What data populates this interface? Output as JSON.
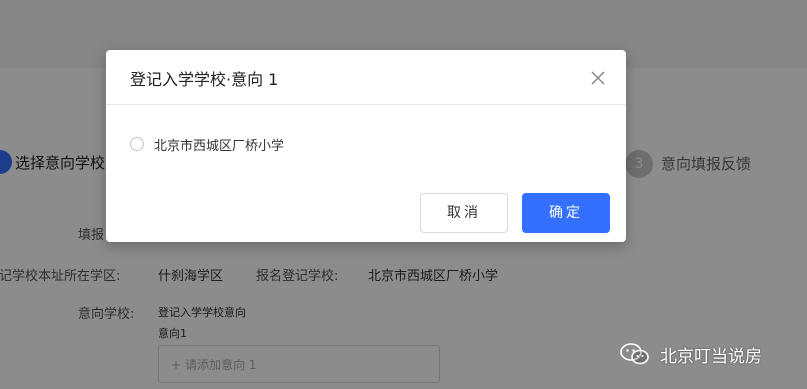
{
  "steps": {
    "step1_label": "选择意向学校",
    "step3_number": "3",
    "step3_label": "意向填报反馈"
  },
  "form": {
    "fill_label": "填报",
    "district_label": "记学校本址所在学区:",
    "district_value": "什刹海学区",
    "school_label": "报名登记学校:",
    "school_value": "北京市西城区厂桥小学",
    "intent_label": "意向学校:",
    "intent_value_line1": "登记入学学校意向",
    "intent_value_line2": "意向1",
    "add_placeholder": "请添加意向 1",
    "add_icon": "plus-icon"
  },
  "modal": {
    "title": "登记入学学校·意向 1",
    "close_icon": "close-icon",
    "option_label": "北京市西城区厂桥小学",
    "cancel_label": "取消",
    "confirm_label": "确定"
  },
  "watermark": {
    "icon": "wechat-icon",
    "text": "北京叮当说房"
  },
  "colors": {
    "primary": "#3370ff",
    "overlay": "rgba(0,0,0,0.45)"
  }
}
